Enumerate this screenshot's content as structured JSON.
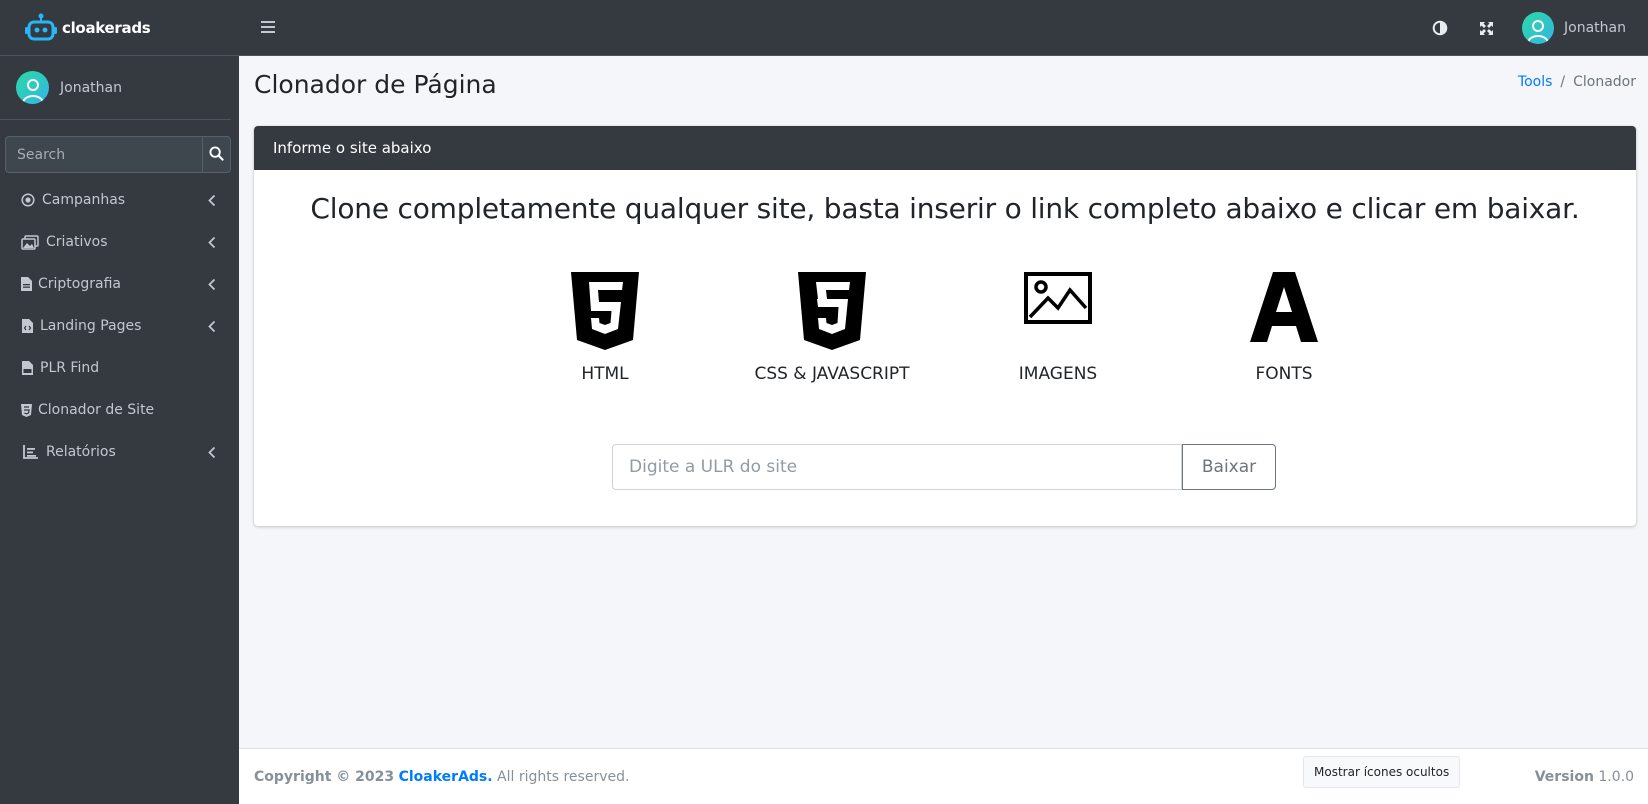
{
  "brand": {
    "name": "cloakerads"
  },
  "sidebar": {
    "user_name": "Jonathan",
    "search_placeholder": "Search",
    "items": [
      {
        "label": "Campanhas",
        "icon": "circle-dot-icon",
        "has_submenu": true
      },
      {
        "label": "Criativos",
        "icon": "images-icon",
        "has_submenu": true
      },
      {
        "label": "Criptografia",
        "icon": "file-icon",
        "has_submenu": true
      },
      {
        "label": "Landing Pages",
        "icon": "file-code-icon",
        "has_submenu": true
      },
      {
        "label": "PLR Find",
        "icon": "file-pdf-icon",
        "has_submenu": false
      },
      {
        "label": "Clonador de Site",
        "icon": "html5-icon",
        "has_submenu": false
      },
      {
        "label": "Relatórios",
        "icon": "chart-line-icon",
        "has_submenu": true
      }
    ]
  },
  "topbar": {
    "user_name": "Jonathan"
  },
  "header": {
    "title": "Clonador de Página",
    "breadcrumb": {
      "link": "Tools",
      "separator": "/",
      "current": "Clonador"
    }
  },
  "card": {
    "title": "Informe o site abaixo",
    "lead": "Clone completamente qualquer site, basta inserir o link completo abaixo e clicar em baixar.",
    "features": [
      {
        "label": "HTML",
        "icon": "html5-icon"
      },
      {
        "label": "CSS & JAVASCRIPT",
        "icon": "css3-icon"
      },
      {
        "label": "IMAGENS",
        "icon": "image-icon"
      },
      {
        "label": "FONTS",
        "icon": "font-icon"
      }
    ],
    "url_placeholder": "Digite a ULR do site",
    "url_value": "",
    "submit_label": "Baixar"
  },
  "footer": {
    "copyright_prefix": "Copyright © 2023",
    "brand_link": "CloakerAds.",
    "rights": "All rights reserved.",
    "hidden_icons_button": "Mostrar ícones ocultos",
    "version_label": "Version",
    "version_value": "1.0.0"
  },
  "colors": {
    "sidebar_bg": "#343a40",
    "accent": "#007bff",
    "content_bg": "#f4f6f9"
  }
}
